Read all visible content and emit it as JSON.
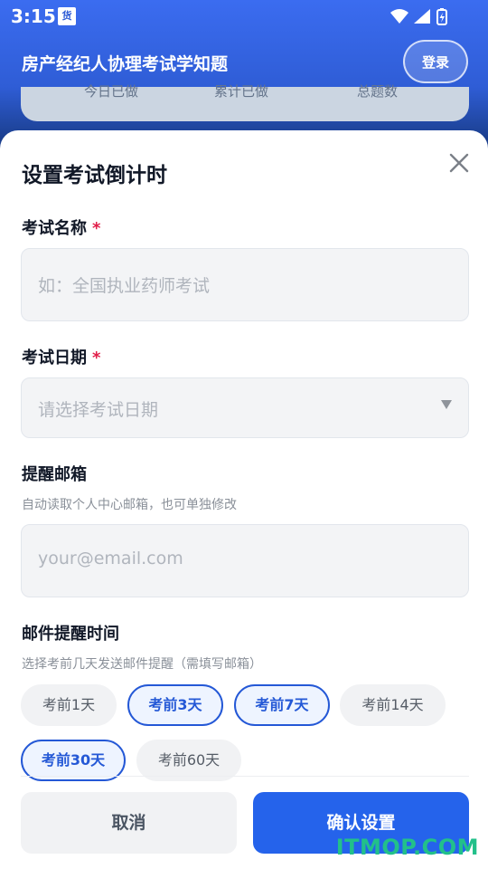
{
  "status_bar": {
    "time": "3:15",
    "notification_badge": "货",
    "icons": [
      "wifi-icon",
      "signal-icon",
      "battery-charging-icon"
    ]
  },
  "app_bar": {
    "title": "房产经纪人协理考试学知题",
    "login_label": "登录"
  },
  "background_card": {
    "stats": [
      "今日已做",
      "累计已做",
      "总题数"
    ]
  },
  "sheet": {
    "title": "设置考试倒计时",
    "required_mark": "*",
    "exam_name": {
      "label": "考试名称",
      "placeholder": "如：全国执业药师考试",
      "value": ""
    },
    "exam_date": {
      "label": "考试日期",
      "placeholder": "请选择考试日期",
      "value": ""
    },
    "email": {
      "label": "提醒邮箱",
      "hint": "自动读取个人中心邮箱，也可单独修改",
      "placeholder": "your@email.com",
      "value": ""
    },
    "reminder": {
      "label": "邮件提醒时间",
      "hint": "选择考前几天发送邮件提醒（需填写邮箱）",
      "options": [
        {
          "label": "考前1天",
          "selected": false
        },
        {
          "label": "考前3天",
          "selected": true
        },
        {
          "label": "考前7天",
          "selected": true
        },
        {
          "label": "考前14天",
          "selected": false
        },
        {
          "label": "考前30天",
          "selected": true
        },
        {
          "label": "考前60天",
          "selected": false
        }
      ]
    },
    "cancel_label": "取消",
    "confirm_label": "确认设置"
  },
  "watermark": "ITMOP.COM",
  "colors": {
    "primary": "#2563eb",
    "required": "#e11d48",
    "app_bar": "#3b6cf0",
    "watermark": "#22c08a"
  }
}
